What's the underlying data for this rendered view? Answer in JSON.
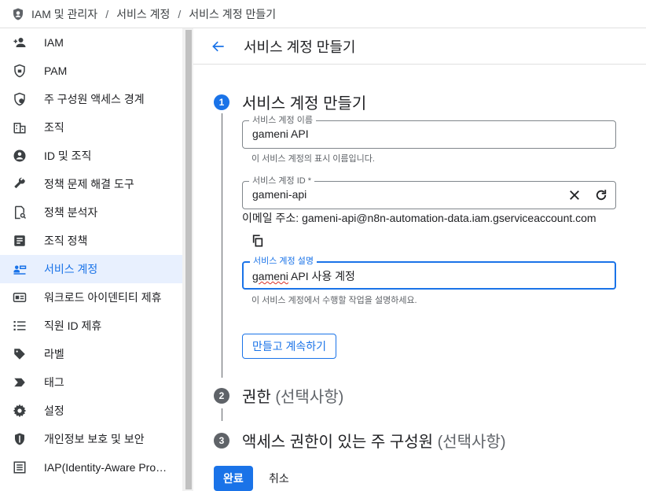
{
  "breadcrumb": {
    "items": [
      "IAM 및 관리자",
      "서비스 계정",
      "서비스 계정 만들기"
    ],
    "separator": "/"
  },
  "sidebar": {
    "items": [
      {
        "label": "IAM",
        "icon": "person-add-icon"
      },
      {
        "label": "PAM",
        "icon": "shield-lock-icon"
      },
      {
        "label": "주 구성원 액세스 경계",
        "icon": "shield-person-icon"
      },
      {
        "label": "조직",
        "icon": "building-icon"
      },
      {
        "label": "ID 및 조직",
        "icon": "account-circle-icon"
      },
      {
        "label": "정책 문제 해결 도구",
        "icon": "wrench-icon"
      },
      {
        "label": "정책 분석자",
        "icon": "doc-search-icon"
      },
      {
        "label": "조직 정책",
        "icon": "list-doc-icon"
      },
      {
        "label": "서비스 계정",
        "icon": "service-account-icon",
        "active": true
      },
      {
        "label": "워크로드 아이덴티티 제휴",
        "icon": "id-card-icon"
      },
      {
        "label": "직원 ID 제휴",
        "icon": "list-icon"
      },
      {
        "label": "라벨",
        "icon": "tag-icon"
      },
      {
        "label": "태그",
        "icon": "chevron-tag-icon"
      },
      {
        "label": "설정",
        "icon": "gear-icon"
      },
      {
        "label": "개인정보 보호 및 보안",
        "icon": "shield-icon"
      },
      {
        "label": "IAP(Identity-Aware Pro…",
        "icon": "iap-icon"
      }
    ]
  },
  "header": {
    "title": "서비스 계정 만들기"
  },
  "steps": [
    {
      "num": "1",
      "title": "서비스 계정 만들기",
      "optional": ""
    },
    {
      "num": "2",
      "title": "권한",
      "optional": "(선택사항)"
    },
    {
      "num": "3",
      "title": "액세스 권한이 있는 주 구성원",
      "optional": "(선택사항)"
    }
  ],
  "form": {
    "name": {
      "label": "서비스 계정 이름",
      "value": "gameni API",
      "hint": "이 서비스 계정의 표시 이름입니다."
    },
    "id": {
      "label": "서비스 계정 ID *",
      "value": "gameni-api"
    },
    "email": {
      "prefix": "이메일 주소: ",
      "value": "gameni-api@n8n-automation-data.iam.gserviceaccount.com"
    },
    "description": {
      "label": "서비스 계정 설명",
      "value_a": "gameni",
      "value_b": " API 사용 계정",
      "hint": "이 서비스 계정에서 수행할 작업을 설명하세요."
    },
    "continue_label": "만들고 계속하기"
  },
  "footer": {
    "done_label": "완료",
    "cancel_label": "취소"
  },
  "colors": {
    "accent": "#1a73e8",
    "active_bg": "#e8f0fe"
  }
}
